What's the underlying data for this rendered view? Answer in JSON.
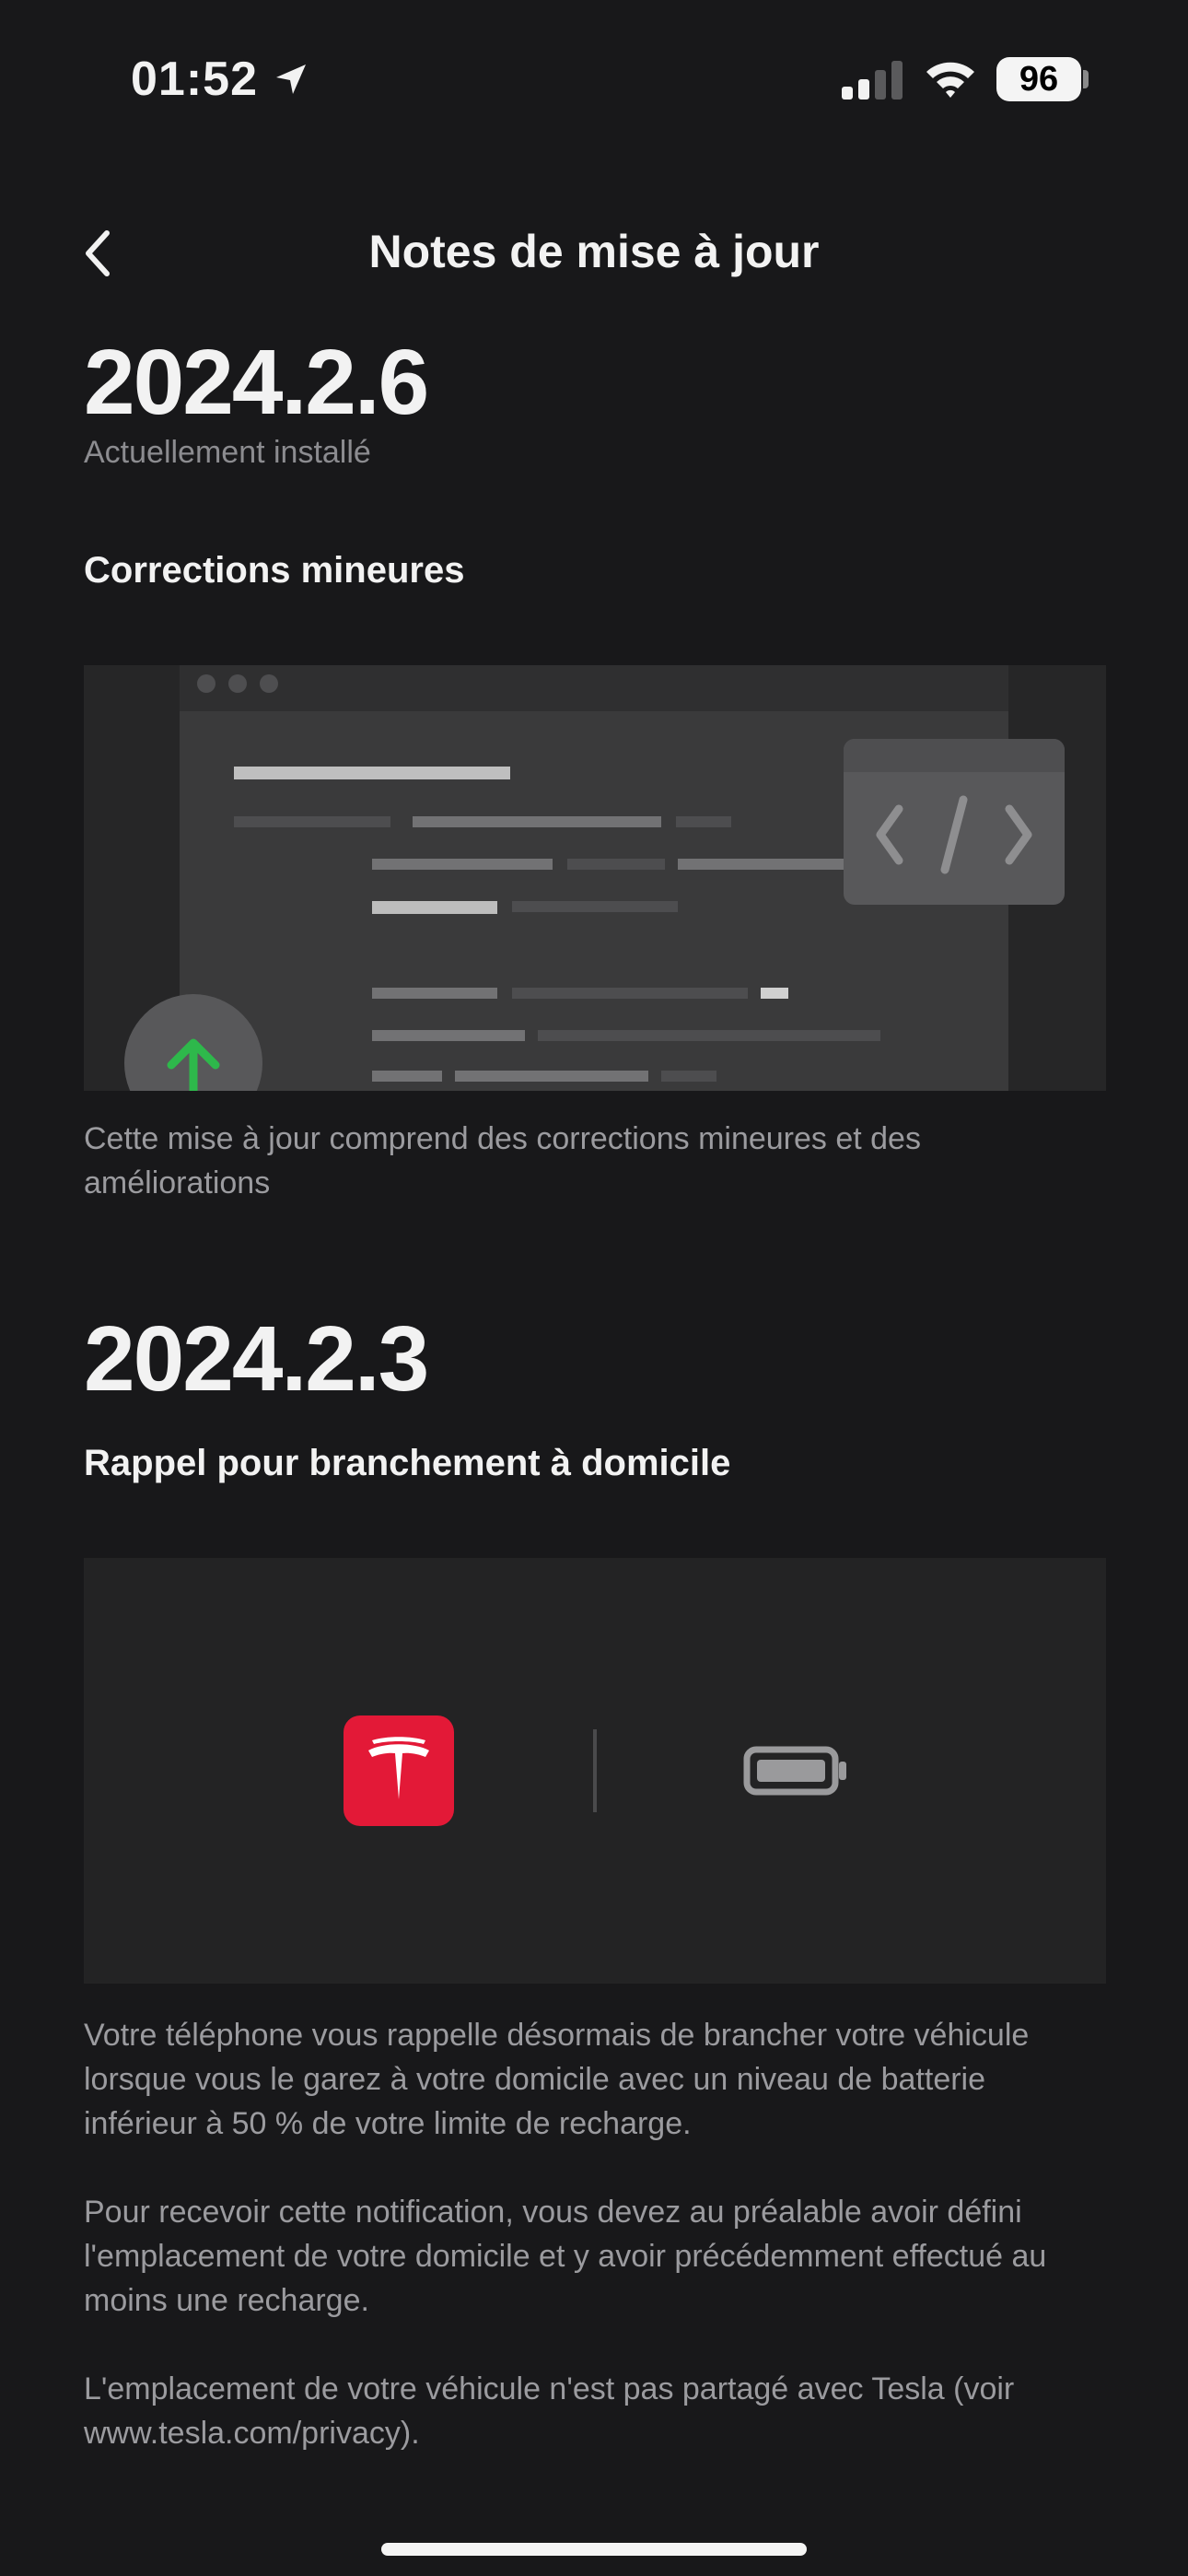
{
  "status_bar": {
    "time": "01:52",
    "battery": "96"
  },
  "nav": {
    "title": "Notes de mise à jour"
  },
  "updates": [
    {
      "version": "2024.2.6",
      "status": "Actuellement installé",
      "title": "Corrections mineures",
      "description": "Cette mise à jour comprend des corrections mineures et des améliorations"
    },
    {
      "version": "2024.2.3",
      "title": "Rappel pour branchement à domicile",
      "paragraphs": [
        "Votre téléphone vous rappelle désormais de brancher votre véhicule lorsque vous le garez à votre domicile avec un niveau de batterie inférieur à 50 % de votre limite de recharge.",
        "Pour recevoir cette notification, vous devez au préalable avoir défini l'emplacement de votre domicile et y avoir précédemment effectué au moins une recharge.",
        "L'emplacement de votre véhicule n'est pas partagé avec Tesla (voir www.tesla.com/privacy)."
      ]
    }
  ],
  "colors": {
    "background": "#18181a",
    "tesla_red": "#e31937",
    "green_arrow": "#2eb84b"
  }
}
